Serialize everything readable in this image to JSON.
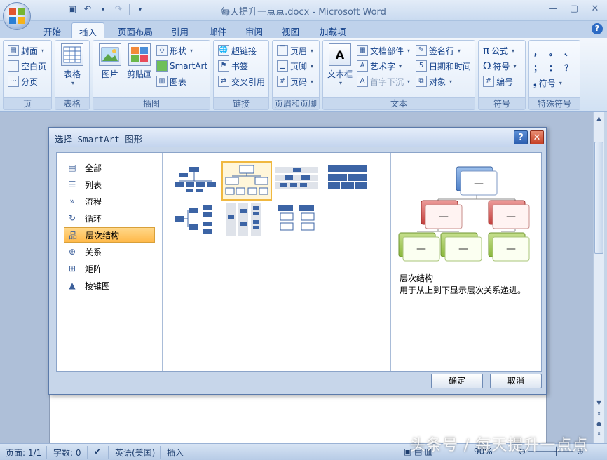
{
  "window": {
    "title": "每天提升一点点.docx - Microsoft Word"
  },
  "qat": {
    "save_icon": "save-icon",
    "undo_icon": "undo-icon",
    "redo_icon": "redo-icon"
  },
  "tabs": [
    {
      "label": "开始"
    },
    {
      "label": "插入"
    },
    {
      "label": "页面布局"
    },
    {
      "label": "引用"
    },
    {
      "label": "邮件"
    },
    {
      "label": "审阅"
    },
    {
      "label": "视图"
    },
    {
      "label": "加载项"
    }
  ],
  "ribbon": {
    "pages_group": {
      "label": "页",
      "cover": "封面",
      "blank": "空白页",
      "break": "分页"
    },
    "tables_group": {
      "label": "表格",
      "table": "表格"
    },
    "illustrations_group": {
      "label": "插图",
      "picture": "图片",
      "clipart": "剪贴画",
      "shapes": "形状",
      "smartart": "SmartArt",
      "chart": "图表"
    },
    "links_group": {
      "label": "链接",
      "hyperlink": "超链接",
      "bookmark": "书签",
      "crossref": "交叉引用"
    },
    "header_footer_group": {
      "label": "页眉和页脚",
      "header": "页眉",
      "footer": "页脚",
      "pagenum": "页码"
    },
    "text_group": {
      "label": "文本",
      "textbox": "文本框",
      "quickparts": "文档部件",
      "wordart": "艺术字",
      "dropcap": "首字下沉",
      "signature": "签名行",
      "datetime": "日期和时间",
      "object": "对象"
    },
    "symbols_group": {
      "label": "符号",
      "equation": "公式",
      "symbol": "符号",
      "number": "编号"
    },
    "special_group": {
      "label": "特殊符号",
      "symbol": "符号",
      "chars": [
        "，",
        "。",
        "、",
        "；",
        "：",
        "？"
      ]
    }
  },
  "dialog": {
    "title": "选择 SmartArt 图形",
    "categories": [
      {
        "label": "全部",
        "icon": "all-icon"
      },
      {
        "label": "列表",
        "icon": "list-icon"
      },
      {
        "label": "流程",
        "icon": "process-icon"
      },
      {
        "label": "循环",
        "icon": "cycle-icon"
      },
      {
        "label": "层次结构",
        "icon": "hierarchy-icon"
      },
      {
        "label": "关系",
        "icon": "relationship-icon"
      },
      {
        "label": "矩阵",
        "icon": "matrix-icon"
      },
      {
        "label": "棱锥图",
        "icon": "pyramid-icon"
      }
    ],
    "selected_category": "层次结构",
    "preview_title": "层次结构",
    "preview_desc": "用于从上到下显示层次关系递进。",
    "ok_label": "确定",
    "cancel_label": "取消"
  },
  "statusbar": {
    "page": "页面: 1/1",
    "words": "字数: 0",
    "language": "英语(美国)",
    "mode": "插入",
    "zoom": "90%"
  },
  "watermark": "头条号 / 每天提升一点点",
  "colors": {
    "accent": "#2c5fb0",
    "selected": "#ffc35c",
    "ribbon_bg": "#dce8f6"
  }
}
